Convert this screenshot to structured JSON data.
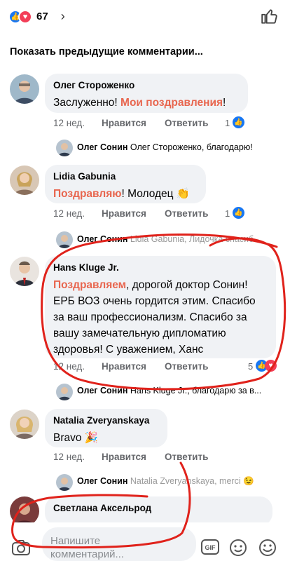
{
  "header": {
    "reaction_count": "67",
    "chevron": "›"
  },
  "show_previous": "Показать предыдущие комментарии...",
  "comments": [
    {
      "name": "Олег Стороженко",
      "text_plain": "Заслуженно! ",
      "text_highlight": "Мои поздравления",
      "text_tail": "!",
      "time": "12 нед.",
      "like": "Нравится",
      "reply": "Ответить",
      "count": "1",
      "reply_item": {
        "name": "Олег Сонин",
        "text": "Олег Стороженко, благодарю!"
      }
    },
    {
      "name": "Lidia Gabunia",
      "text_highlight": "Поздравляю",
      "text_plain": "! Молодец ",
      "emoji": "👏",
      "time": "12 нед.",
      "like": "Нравится",
      "reply": "Ответить",
      "count": "1",
      "reply_item": {
        "name": "Олег Сонин",
        "text": "Lidia Gabunia, Лидочка спасиб..."
      }
    },
    {
      "name": "Hans Kluge Jr.",
      "text_highlight": "Поздравляем",
      "text_line1_tail": ", дорогой доктор Сонин!",
      "text_lines": [
        "ЕРБ ВОЗ очень гордится этим. Спасибо",
        "за ваш профессионализм. Спасибо за",
        "вашу замечательную дипломатию",
        "здоровья! С уважением, Ханс"
      ],
      "time": "12 нед.",
      "like": "Нравится",
      "reply": "Ответить",
      "count": "5",
      "reply_item": {
        "name": "Олег Сонин",
        "text": "Hans Kluge Jr., благодарю за в..."
      }
    },
    {
      "name": "Natalia Zveryanskaya",
      "text_plain": "Bravo ",
      "emoji": "🎉",
      "time": "12 нед.",
      "like": "Нравится",
      "reply": "Ответить",
      "reply_item": {
        "name": "Олег Сонин",
        "text": "Natalia Zveryanskaya, merci ",
        "emoji": "😉"
      }
    },
    {
      "name": "Светлана Аксельрод"
    }
  ],
  "composer": {
    "placeholder": "Напишите комментарий...",
    "gif": "GIF"
  },
  "colors": {
    "accent_highlight": "#e8664f",
    "like_blue": "#1877f2",
    "love_red": "#f33e58",
    "annotation_red": "#e0221b"
  }
}
